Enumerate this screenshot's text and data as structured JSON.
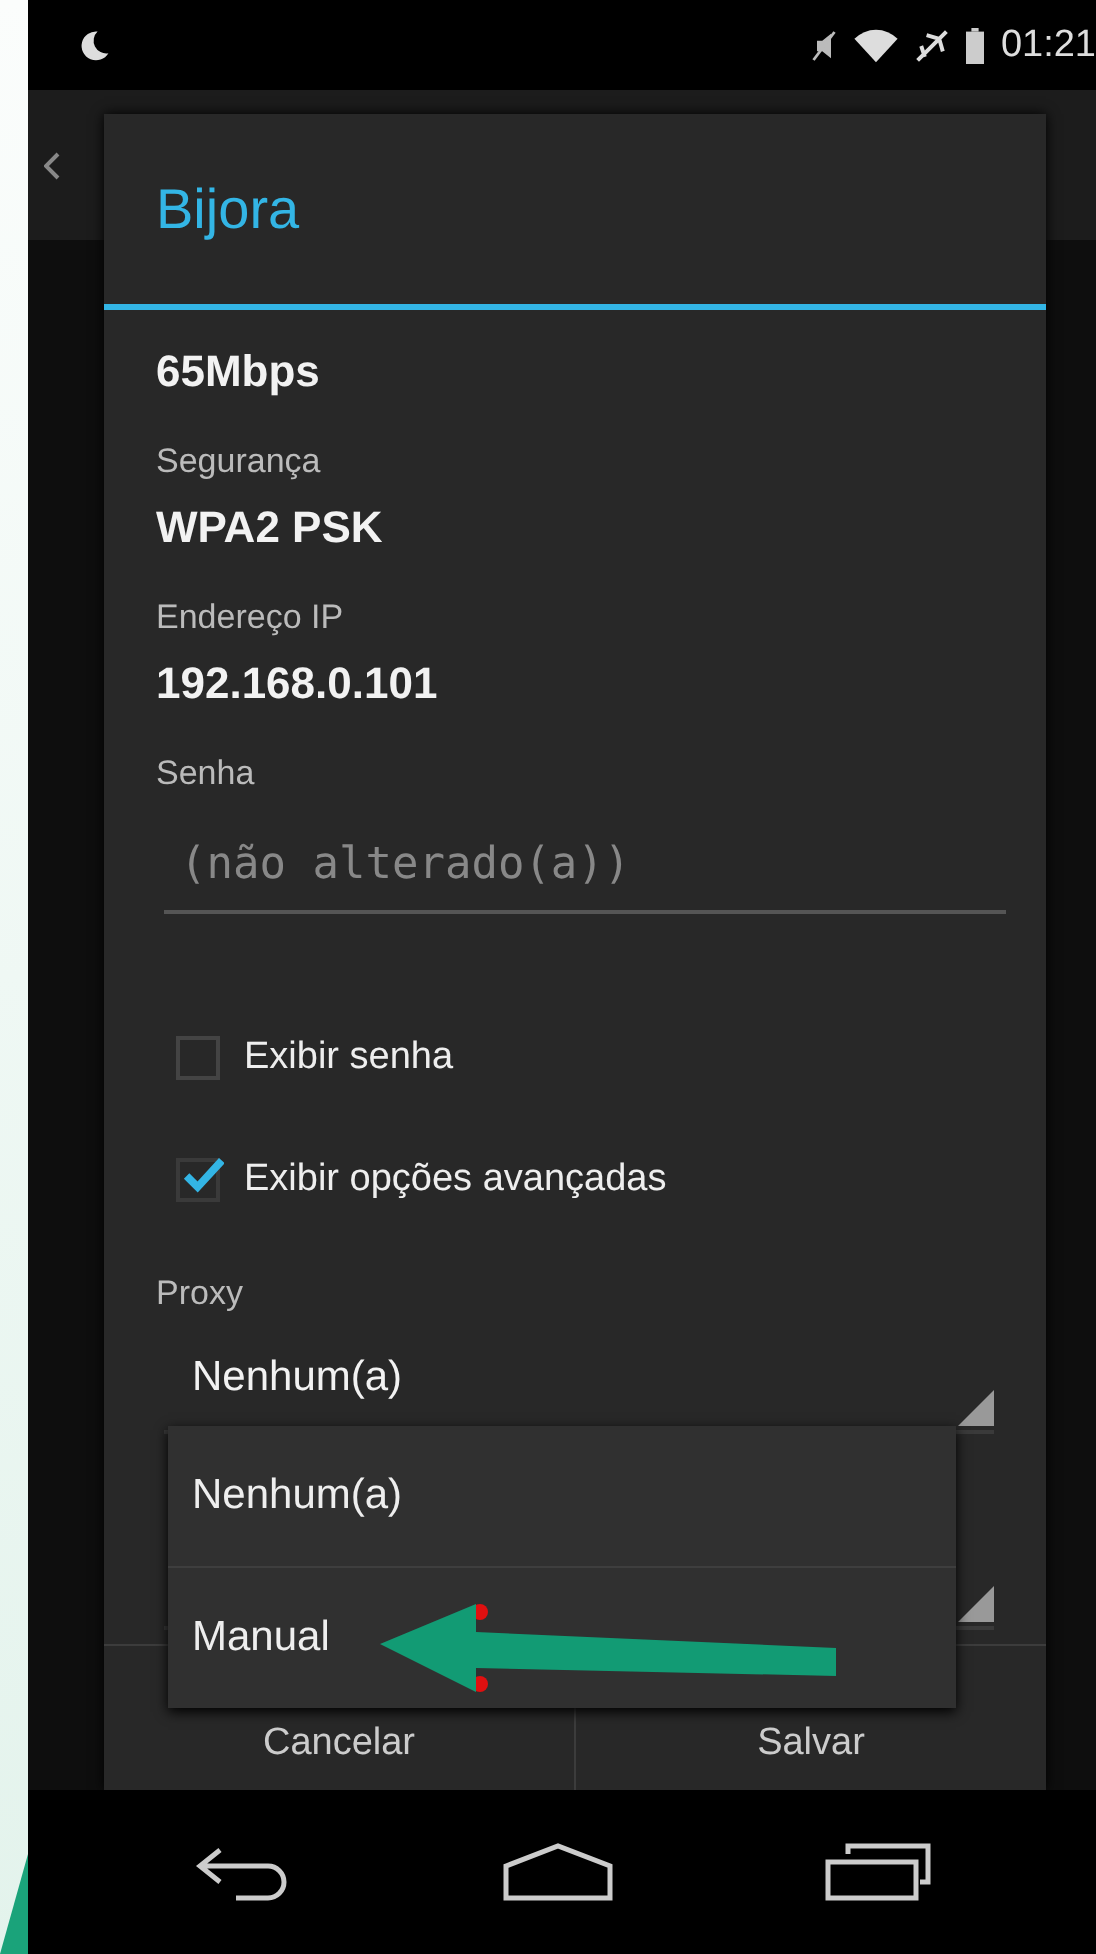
{
  "status_bar": {
    "time": "01:21"
  },
  "dialog": {
    "title": "Bijora",
    "link_speed": {
      "value": "65Mbps"
    },
    "details": [
      {
        "label": "Segurança",
        "value": "WPA2 PSK"
      },
      {
        "label": "Endereço IP",
        "value": "192.168.0.101"
      }
    ],
    "password": {
      "label": "Senha",
      "placeholder": "(não alterado(a))"
    },
    "checkboxes": [
      {
        "label": "Exibir senha",
        "checked": false
      },
      {
        "label": "Exibir opções avançadas",
        "checked": true
      }
    ],
    "proxy": {
      "label": "Proxy",
      "value": "Nenhum(a)"
    },
    "dropdown": {
      "options": [
        "Nenhum(a)",
        "Manual"
      ]
    },
    "buttons": [
      "Cancelar",
      "Salvar"
    ]
  }
}
